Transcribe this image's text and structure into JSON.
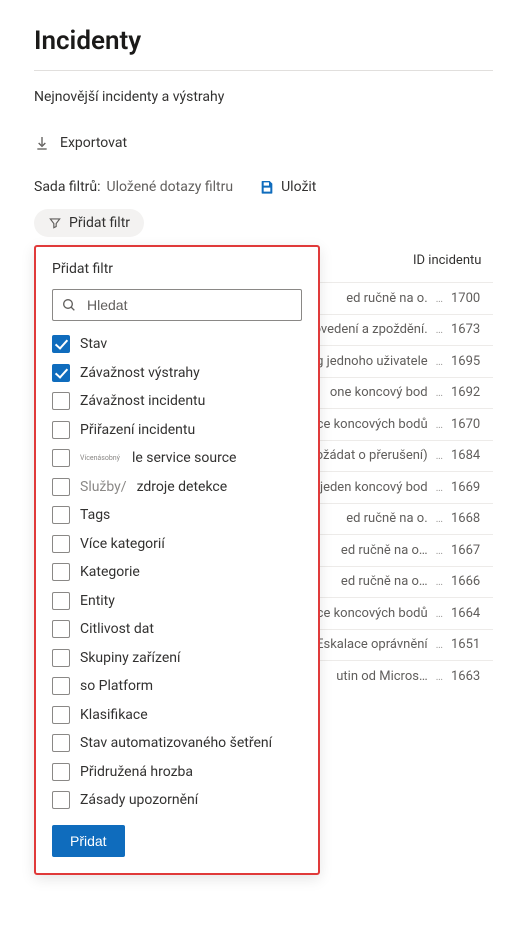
{
  "header": {
    "title": "Incidenty",
    "subtitle": "Nejnovější incidenty a výstrahy",
    "export_label": "Exportovat"
  },
  "filterset": {
    "label": "Sada filtrů:",
    "value": "Uložené dotazy filtru",
    "save_label": "Uložit",
    "add_filter_label": "Přidat filtr"
  },
  "table": {
    "columns": {
      "id": "ID incidentu"
    },
    "rows": [
      {
        "name_tail": "ed ručně na o.",
        "id": "1700"
      },
      {
        "name_tail": "Provedení a zpoždění.",
        "id": "1673"
      },
      {
        "name_tail": "Irving jednoho uživatele",
        "id": "1695"
      },
      {
        "name_tail": "one koncový bod",
        "id": "1692"
      },
      {
        "name_tail": "více koncových bodů",
        "id": "1670"
      },
      {
        "name_tail": "tpožádat o přerušení)",
        "id": "1684"
      },
      {
        "name_tail": "on jeden koncový bod",
        "id": "1669"
      },
      {
        "name_tail": "ed ručně na o.",
        "id": "1668"
      },
      {
        "name_tail": "ed ručně na o…",
        "id": "1667"
      },
      {
        "name_tail": "ed ručně na o…",
        "id": "1666"
      },
      {
        "name_tail": "více koncových bodů",
        "id": "1664"
      },
      {
        "name_tail": "Eskalace oprávnění",
        "id": "1651"
      },
      {
        "name_tail": "utin od Micros…",
        "id": "1663"
      }
    ]
  },
  "filter_panel": {
    "title": "Přidat filtr",
    "search_placeholder": "Hledat",
    "add_button": "Přidat",
    "options": [
      {
        "label": "Stav",
        "checked": true
      },
      {
        "label": "Závažnost výstrahy",
        "checked": true
      },
      {
        "label": "Závažnost incidentu",
        "checked": false
      },
      {
        "label": "Přiřazení incidentu",
        "checked": false
      },
      {
        "label": "le service source",
        "checked": false,
        "prefix_tiny": "Vícenásobný"
      },
      {
        "label": "zdroje detekce",
        "checked": false,
        "prefix_mid": "Služby/"
      },
      {
        "label": "Tags",
        "checked": false
      },
      {
        "label": "Více kategorií",
        "checked": false
      },
      {
        "label": "Kategorie",
        "checked": false
      },
      {
        "label": "Entity",
        "checked": false
      },
      {
        "label": "Citlivost dat",
        "checked": false
      },
      {
        "label": "Skupiny zařízení",
        "checked": false
      },
      {
        "label": "so Platform",
        "checked": false
      },
      {
        "label": "Klasifikace",
        "checked": false
      },
      {
        "label": "Stav automatizovaného šetření",
        "checked": false
      },
      {
        "label": "Přidružená hrozba",
        "checked": false
      },
      {
        "label": "Zásady upozornění",
        "checked": false
      }
    ]
  },
  "colors": {
    "accent": "#0f6cbd",
    "highlight_border": "#e03a3a"
  }
}
